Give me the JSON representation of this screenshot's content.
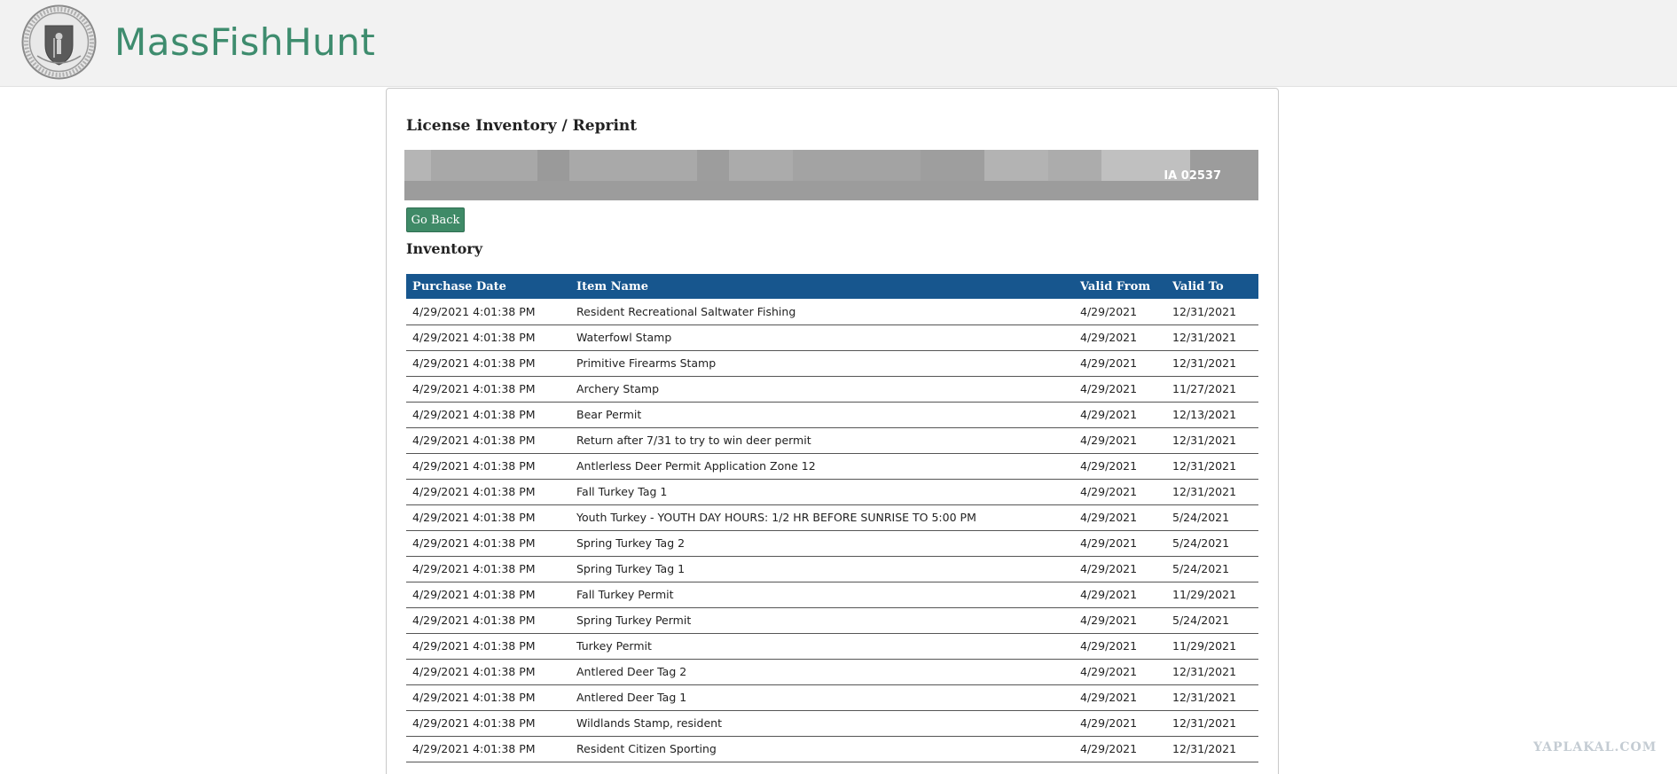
{
  "header": {
    "site_title": "MassFishHunt",
    "seal_icon": "state-seal-icon"
  },
  "page": {
    "heading": "License Inventory / Reprint",
    "customer_info_visible": "IA 02537",
    "go_back_label": "Go Back",
    "section_heading": "Inventory"
  },
  "table": {
    "columns": [
      "Purchase Date",
      "Item Name",
      "Valid From",
      "Valid To"
    ],
    "rows": [
      [
        "4/29/2021 4:01:38 PM",
        "Resident Recreational Saltwater Fishing",
        "4/29/2021",
        "12/31/2021"
      ],
      [
        "4/29/2021 4:01:38 PM",
        "Waterfowl Stamp",
        "4/29/2021",
        "12/31/2021"
      ],
      [
        "4/29/2021 4:01:38 PM",
        "Primitive Firearms Stamp",
        "4/29/2021",
        "12/31/2021"
      ],
      [
        "4/29/2021 4:01:38 PM",
        "Archery Stamp",
        "4/29/2021",
        "11/27/2021"
      ],
      [
        "4/29/2021 4:01:38 PM",
        "Bear Permit",
        "4/29/2021",
        "12/13/2021"
      ],
      [
        "4/29/2021 4:01:38 PM",
        "Return after 7/31 to try to win deer permit",
        "4/29/2021",
        "12/31/2021"
      ],
      [
        "4/29/2021 4:01:38 PM",
        "Antlerless Deer Permit Application Zone 12",
        "4/29/2021",
        "12/31/2021"
      ],
      [
        "4/29/2021 4:01:38 PM",
        "Fall Turkey Tag 1",
        "4/29/2021",
        "12/31/2021"
      ],
      [
        "4/29/2021 4:01:38 PM",
        "Youth Turkey - YOUTH DAY HOURS: 1/2 HR BEFORE SUNRISE TO 5:00 PM",
        "4/29/2021",
        "5/24/2021"
      ],
      [
        "4/29/2021 4:01:38 PM",
        "Spring Turkey Tag 2",
        "4/29/2021",
        "5/24/2021"
      ],
      [
        "4/29/2021 4:01:38 PM",
        "Spring Turkey Tag 1",
        "4/29/2021",
        "5/24/2021"
      ],
      [
        "4/29/2021 4:01:38 PM",
        "Fall Turkey Permit",
        "4/29/2021",
        "11/29/2021"
      ],
      [
        "4/29/2021 4:01:38 PM",
        "Spring Turkey Permit",
        "4/29/2021",
        "5/24/2021"
      ],
      [
        "4/29/2021 4:01:38 PM",
        "Turkey Permit",
        "4/29/2021",
        "11/29/2021"
      ],
      [
        "4/29/2021 4:01:38 PM",
        "Antlered Deer Tag 2",
        "4/29/2021",
        "12/31/2021"
      ],
      [
        "4/29/2021 4:01:38 PM",
        "Antlered Deer Tag 1",
        "4/29/2021",
        "12/31/2021"
      ],
      [
        "4/29/2021 4:01:38 PM",
        "Wildlands Stamp, resident",
        "4/29/2021",
        "12/31/2021"
      ],
      [
        "4/29/2021 4:01:38 PM",
        "Resident Citizen Sporting",
        "4/29/2021",
        "12/31/2021"
      ]
    ]
  },
  "watermark": "YAPLAKAL.COM",
  "colors": {
    "brand_green": "#3e8c6e",
    "table_header_blue": "#17568e",
    "button_green": "#3f8a67"
  }
}
